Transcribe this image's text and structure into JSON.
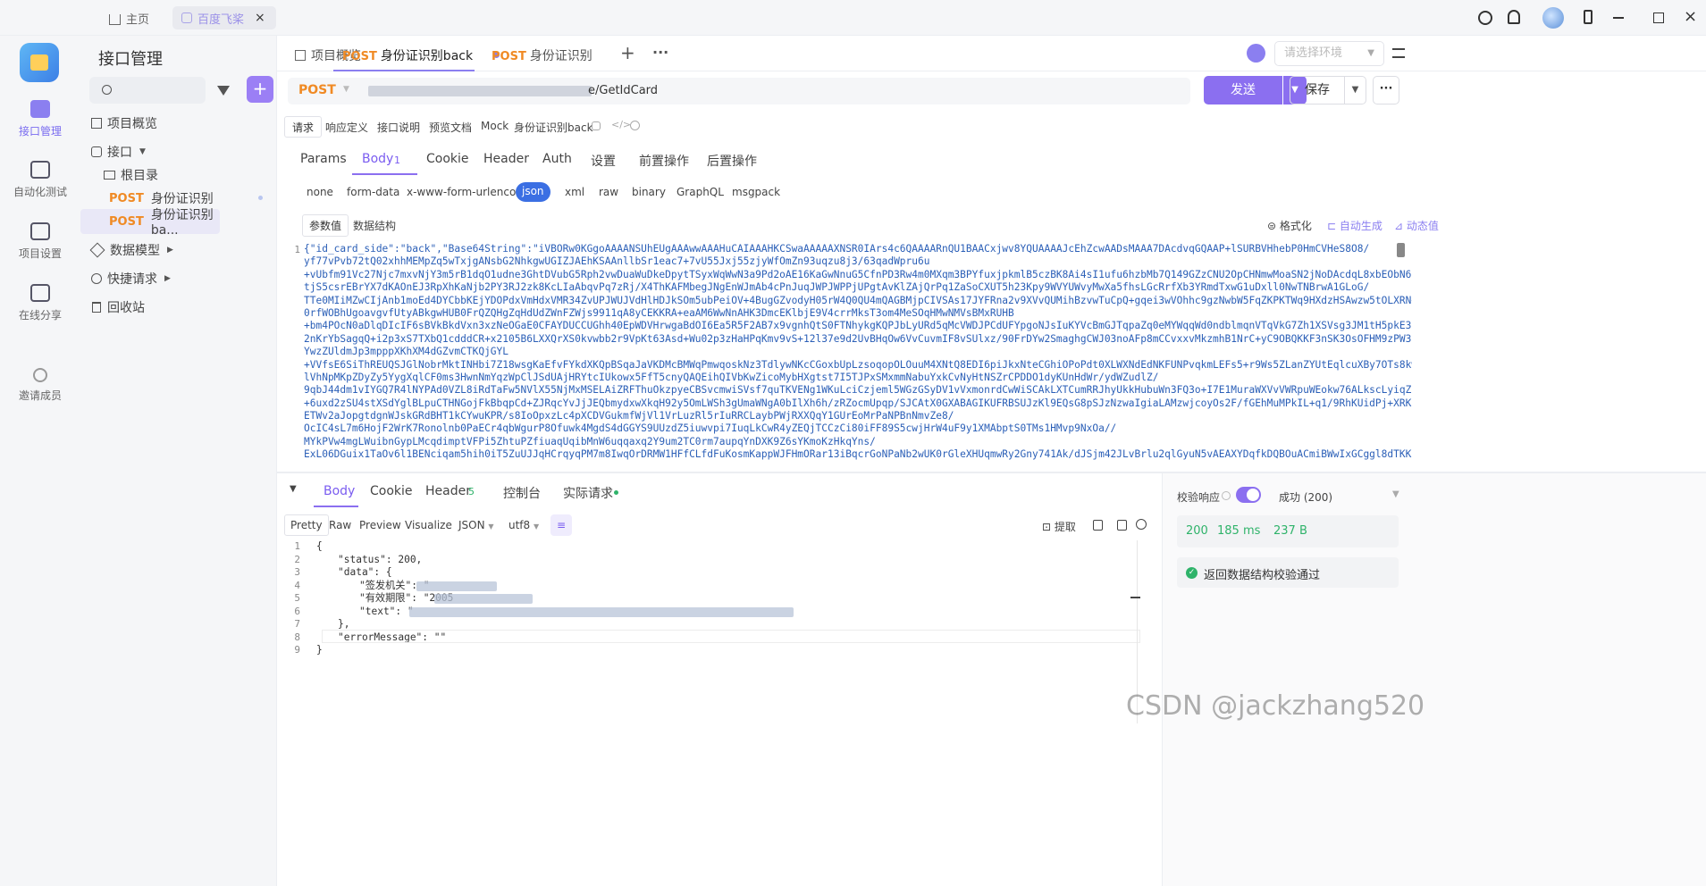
{
  "titlebar": {
    "home_label": "主页",
    "active_tab": "百度飞桨",
    "close": "×"
  },
  "leftnav": {
    "items": [
      "接口管理",
      "自动化测试",
      "项目设置",
      "在线分享",
      "邀请成员"
    ]
  },
  "sidebar": {
    "title": "接口管理",
    "tree": {
      "overview": "项目概览",
      "interfaces": "接口",
      "root": "根目录",
      "req1_method": "POST",
      "req1_name": "身份证识别",
      "req2_method": "POST",
      "req2_name": "身份证识别ba...",
      "models": "数据模型",
      "quick": "快捷请求",
      "trash": "回收站"
    }
  },
  "tabs": {
    "overview": "项目概览",
    "tab1_method": "POST",
    "tab1_name": "身份证识别back",
    "tab2_method": "POST",
    "tab2_name": "身份证识别",
    "plus": "+",
    "more": "···",
    "env_placeholder": "请选择环境"
  },
  "request": {
    "method": "POST",
    "url_end": "e/GetIdCard",
    "send": "发送",
    "save": "保存"
  },
  "subtabs": {
    "items": [
      "请求",
      "响应定义",
      "接口说明",
      "预览文档",
      "Mock"
    ],
    "name": "身份证识别back"
  },
  "reqtabs": {
    "items": [
      "Params",
      "Body",
      "Cookie",
      "Header",
      "Auth",
      "设置",
      "前置操作",
      "后置操作"
    ],
    "body_count": "1"
  },
  "bodytypes": [
    "none",
    "form-data",
    "x-www-form-urlencoded",
    "json",
    "xml",
    "raw",
    "binary",
    "GraphQL",
    "msgpack"
  ],
  "editor": {
    "param_tab": "参数值",
    "schema_tab": "数据结构",
    "format": "格式化",
    "autogen": "自动生成",
    "dynamic": "动态值"
  },
  "code_lines": [
    "{\"id_card_side\":\"back\",\"Base64String\":\"iVBORw0KGgoAAAANSUhEUgAAAwwAAAHuCAIAAAHKCSwaAAAAAXNSR0IArs4c6QAAAARnQU1BAACxjwv8YQUAAAAJcEhZcwAADsMAAA7DAcdvqGQAAP+lSURBVHhebP0HmCVHeS8O8/",
    "yf77vPvb72tQ02xhhMEMpZq5wTxjgANsbG2NhkgwUGIZJAEhKSAAnllbSr1eac7+7vU55Jxj55zjyWfOmZn93uqzu8j3/63qadWpru6u",
    "+vUbfm91Vc27Njc7mxvNjY3m5rB1dqO1udne3GhtDVubG5Rph2vwDuaWuDkeDpytTSyxWqWwN3a9Pd2oAE16KaGwNnuG5CfnPD3Rw4m0MXqm3BPYfuxjpkmlB5czBK8Ai4sI1ufu6hzbMb7Q149GZzCNU2OpCHNmwMoaSN2jNoDAcdqL8xbEObN6B5A7hzd2urO4Szm62",
    "tjS5csrEBrYX7dKAOnEJ3RpXhKaNjb2PY3RJ2zk8KcLIaAbqvPq7zRj/X4ThKAFMbegJNgEnWJmAb4cPnJuqJWPJWPPjUPgtAvKlZAjQrPq1ZaSoCXUT5h23Kpy9WVYUWvyMwXa5fhsLGcRrfXb3YRmdTxwG1uDxll0NwTNBrwA1GLoG/",
    "TTe0MIiMZwCIjAnb1moEd4DYCbbKEjYDOPdxVmHdxVMR34ZvUPJWUJVdHlHDJkSOm5ubPeiOV+4BugGZvodyH05rW4Q0QU4mQAGBMjpCIVSAs17JYFRna2v9XVvQUMihBzvwTuCpQ+gqei3wVOhhc9gzNwbW5FqZKPKTWq9HXdzHSAwzw5tOLXRN+HsoC8N+qwZ2/",
    "0rfWOBhUgoavgvfUtyABkgwHUB0FrQZQHgZqHdUdZWnFZWjs9911qA8yCEKKRA+eaAM6WwNnAHK3DmcEKlbjE9V4crrMksT3om4MeSOqHMwNMVsBMxRUHB",
    "+bm4POcN0aDlqDIcIF6sBVkBkdVxn3xzNeOGaE0CFAYDUCCUGhh40EpWDVHrwgaBdOI6Ea5R5F2AB7x9vgnhQtS0FTNhykgKQPJbLyURd5qMcVWDJPCdUFYpgoNJsIuKYVcBmGJTqpaZq0eMYWqqWd0ndblmqnVTqVkG7Zh1XSVsg3JM1tH5pkE3LbbbFJsO1",
    "2nKrYbSagqQ+i2p3xS7TXbQ1cdddCR+x2105B6LXXQrXS0kvwbb2r9VpKt63Asd+Wu02p3zHaHPqKmv9vS+12l37e9d2UvBHqOw6VvCuvmIF8vSUlxz/90FrDYw2SmaghgCWJ03noAFp8mCCvxxvMkzmhB1NrC+yC9OBQKKF3nSK3OsOFHM9zPW3h0gIdK1EJQauKGs+zqzWi4/",
    "YwzZUldmJp3mpppXKhXM4dGZvmCTKQjGYL",
    "+VVfsE6SiThREUQSJGlNobrMktINHbi7Z18wsgKaEfvFYkdXKQpBSqaJaVKDMcBMWqPmwqoskNz3TdlywNKcCGoxbUpLzsoqopOLOuuM4XNtQ8EDI6piJkxNteCGhiOPoPdt0XLWXNdEdNKFUNPvqkmLEFs5+r9Ws5ZLanZYUtEqlcuXBy7OTs8kw8FYzFQvGo3x9bWwsG4qG5tag/",
    "lVhNpMKpZDyZy5YygXqlCF0ms3HwnNmYqzWpClJSdUAjHRYtcIUkowx5FfT5cnyQAQEihQIVbKwZicoMybHXgtst7I5TJPxSMxmmNabuYxkCvNyHtNSZrCPDDO1dyKUnHdWr/ydWZudlZ/",
    "9qbJ44dm1vIYGQ7R4lNYPAd0VZL8iRdTaFw5NVlX55NjMxMSELAiZRFThuOkzpyeCBSvcmwiSVsf7quTKVENg1WKuLciCzjeml5WGzGSyDV1vVxmonrdCwWiSCAkLXTCumRRJhyUkkHubuWn3FQ3o+I7E1MuraWXVvVWRpuWEokw76ALkscLyiqZDfbisxxHGPwTCSV2bcQ/",
    "+6uxd2zSU4stXSdYglBLpuCTHNGojFkBbqpCd+ZJRqcYvJjJEQbmydxwXkqH92y5OmLWSh3gUmaWNgA0bIlXh6h/zRZocmUpqp/SJCAtX0GXABAGIKUFRBSUJzKl9EQsG8pSJzNzwaIgiaLAMzwjcoyOs2F/fGEhMuMPkIL+q1/9RhKUidPj+XRKZtliMjV3/",
    "ETWv2aJopgtdgnWJskGRdBHT1kCYwuKPR/s8IoOpxzLc4pXCDVGukmfWjVl1VrLuzRl5rIuRRCLaybPWjRXXQqY1GUrEoMrPaNPBnNmvZe8/",
    "OcIC4sL7m6HojF2WrK7Ronolnb0PaECr4qbWgurP8Ofuwk4MgdS4dGGYS9UUzdZ5iuwvpi7IuqLkCwR4yZEQjTCCzCi80iFF89S5cwjHrW4uF9y1XMAbptS0TMs1HMvp9NxOa//",
    "MYkPVw4mgLWuibnGypLMcqdimptVFPi5ZhtuPZfiuaqUqibMnW6uqqaxq2Y9um2TC0rm7aupqYnDXK9Z6sYKmoKzHkqYns/",
    "ExL06DGuix1TaOv6l1BENciqam5hih0iT5ZuUJJqHCrqyqPM7m8IwqOrDRMW1HFfCLfdFuKosmKappWJFHmORar13iBqcrGoNPaNb2wUK0rGleXHUqmwRy2Gny741Ak/dJSjm42JLvBrlu2qlGyuN5vAEAXYDqfkDQBOuACmiBWwIxGCggl8dTKK/"
  ],
  "response": {
    "tabs": [
      "Body",
      "Cookie",
      "Header",
      "控制台",
      "实际请求"
    ],
    "header_count": "5",
    "views": [
      "Pretty",
      "Raw",
      "Preview",
      "Visualize"
    ],
    "lang": "JSON",
    "charset": "utf8",
    "extract": "提取",
    "lines": [
      "{",
      "\"status\": 200,",
      "\"data\": {",
      "\"签发机关\": \"",
      "\"有效期限\": \"2005",
      "\"text\": \"",
      "},",
      "\"errorMessage\": \"\"",
      "}"
    ]
  },
  "result": {
    "validate_label": "校验响应",
    "success": "成功 (200)",
    "status": "200",
    "time": "185 ms",
    "size": "237 B",
    "check_msg": "返回数据结构校验通过"
  },
  "watermark": "CSDN @jackzhang520"
}
